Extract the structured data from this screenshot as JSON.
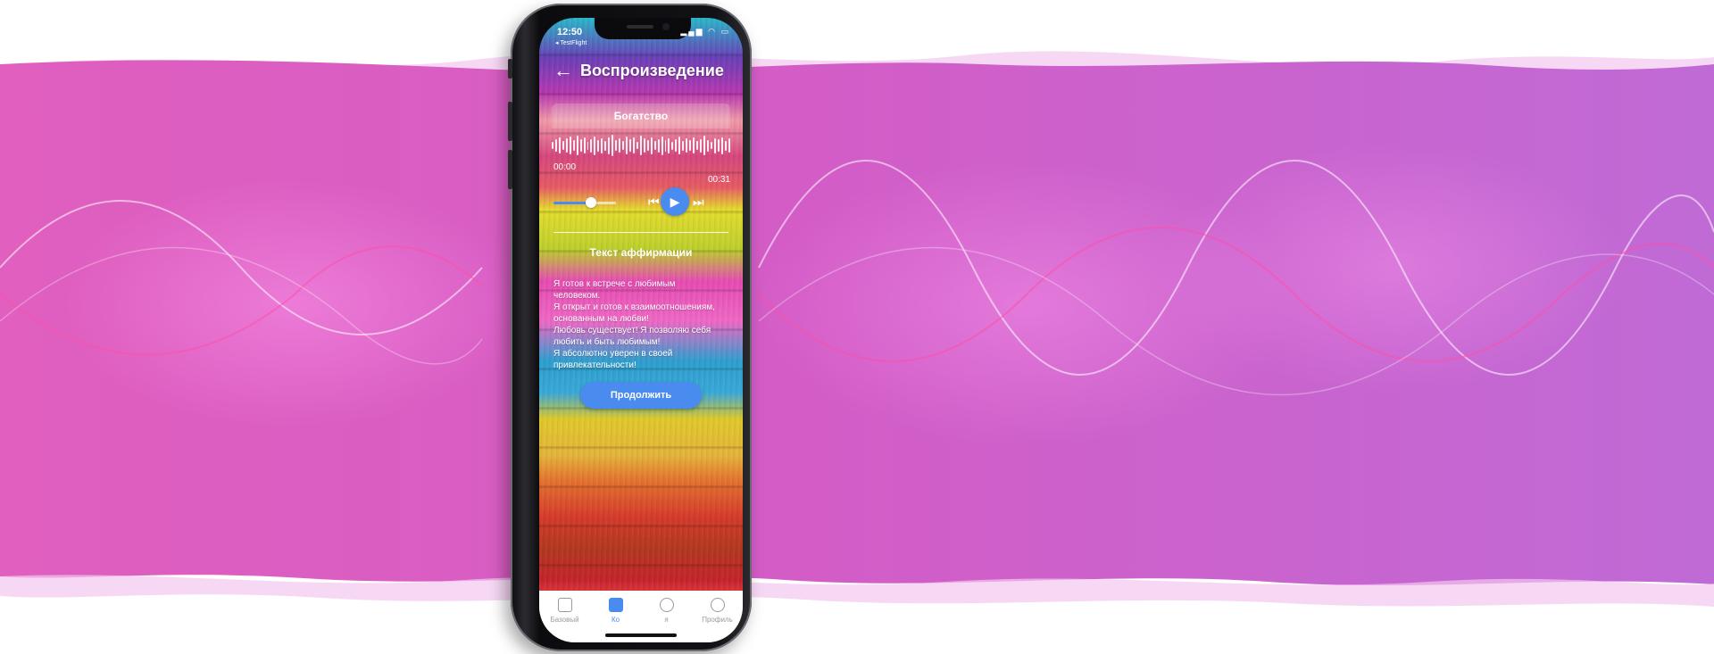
{
  "colors": {
    "accent": "#4a8bf0",
    "band_left": "#e05fbf",
    "band_right": "#c06ad6"
  },
  "status_bar": {
    "time": "12:50",
    "back_app": "◂ TestFlight"
  },
  "header": {
    "back_icon": "arrow-left-icon",
    "title": "Воспроизведение"
  },
  "player": {
    "track_title": "Богатство",
    "time_current": "00:00",
    "time_total": "00:31",
    "volume_level": 0.6
  },
  "affirmation": {
    "title": "Текст аффирмации",
    "lines": [
      "Я готов к встрече с любимым",
      "человеком.",
      "Я открыт и готов к взаимоотношениям,",
      "основанным на любви!",
      "Любовь существует! Я позволяю себя",
      "любить и быть любимым!",
      "Я абсолютно уверен в своей",
      "привлекательности!"
    ],
    "continue_label": "Продолжить"
  },
  "tabbar": {
    "items": [
      {
        "label": "Базовый",
        "icon": "bag-icon",
        "active": false
      },
      {
        "label": "Ко",
        "icon": "briefcase-icon",
        "active": true
      },
      {
        "label": "я",
        "icon": "award-icon",
        "active": false
      },
      {
        "label": "Профиль",
        "icon": "person-icon",
        "active": false
      }
    ]
  }
}
